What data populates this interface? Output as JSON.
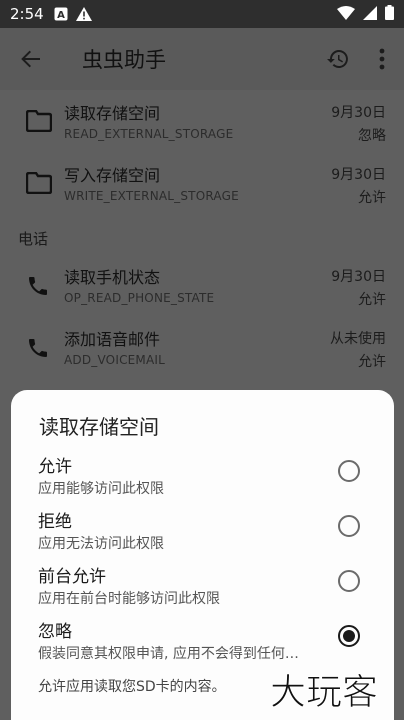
{
  "status_bar": {
    "time": "2:54",
    "notification_icons": [
      "text-a-icon",
      "warning-icon"
    ],
    "right_icons": [
      "wifi-icon",
      "signal-icon",
      "battery-icon"
    ]
  },
  "toolbar": {
    "title": "虫虫助手",
    "back_icon": "arrow-back-icon",
    "history_icon": "history-icon",
    "more_icon": "more-vert-icon"
  },
  "permissions": [
    {
      "name": "读取存储空间",
      "code": "READ_EXTERNAL_STORAGE",
      "date": "9月30日",
      "state": "忽略",
      "icon": "folder-icon"
    },
    {
      "name": "写入存储空间",
      "code": "WRITE_EXTERNAL_STORAGE",
      "date": "9月30日",
      "state": "允许",
      "icon": "folder-icon"
    },
    {
      "name": "读取手机状态",
      "code": "OP_READ_PHONE_STATE",
      "date": "9月30日",
      "state": "允许",
      "icon": "phone-icon"
    },
    {
      "name": "添加语音邮件",
      "code": "ADD_VOICEMAIL",
      "date": "从未使用",
      "state": "允许",
      "icon": "phone-icon"
    }
  ],
  "section_phone": "电话",
  "sheet": {
    "title": "读取存储空间",
    "options": [
      {
        "label": "允许",
        "desc": "应用能够访问此权限",
        "checked": false
      },
      {
        "label": "拒绝",
        "desc": "应用无法访问此权限",
        "checked": false
      },
      {
        "label": "前台允许",
        "desc": "应用在前台时能够访问此权限",
        "checked": false
      },
      {
        "label": "忽略",
        "desc": "假装同意其权限申请, 应用不会得到任何数据",
        "checked": true
      }
    ],
    "footer": "允许应用读取您SD卡的内容。"
  },
  "watermark": "大玩客"
}
